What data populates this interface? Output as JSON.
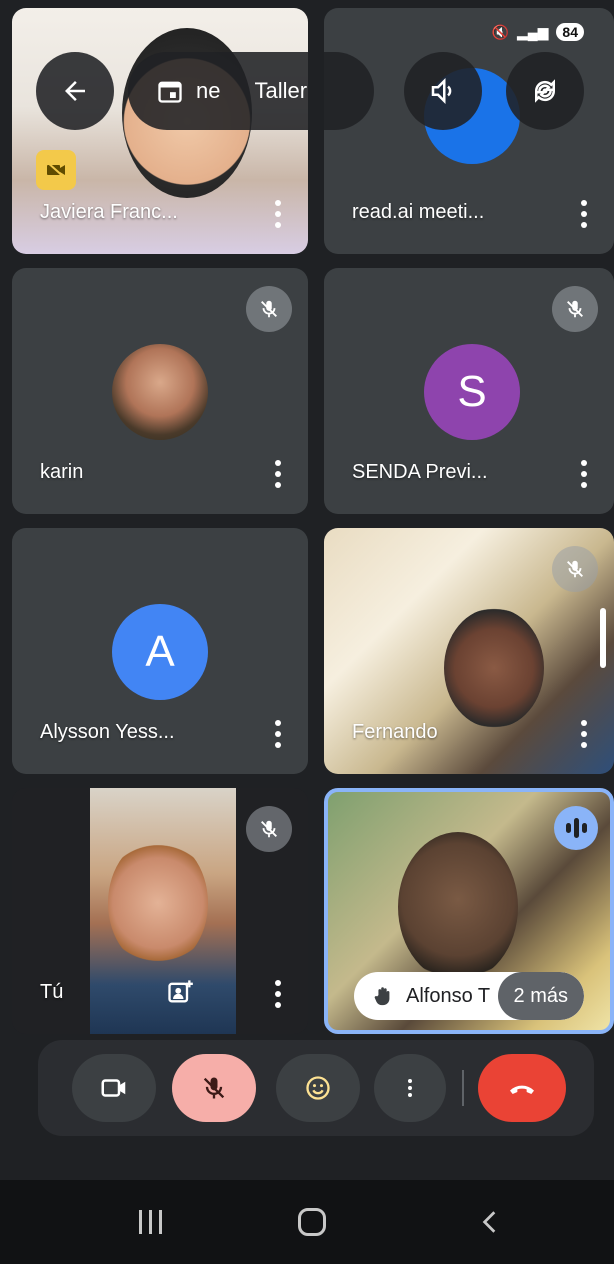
{
  "status_bar": {
    "battery": "84"
  },
  "top_bar": {
    "meeting_title_partial": "ne",
    "meeting_title_partial_2": "Taller"
  },
  "tiles": {
    "javiera": {
      "name": "Javiera Franc..."
    },
    "readai": {
      "name": "read.ai meeti...",
      "avatar_color": "#1a73e8"
    },
    "karin": {
      "name": "karin"
    },
    "senda": {
      "name": "SENDA Previ...",
      "avatar_letter": "S",
      "avatar_color": "#8e44ad"
    },
    "alysson": {
      "name": "Alysson Yess...",
      "avatar_letter": "A",
      "avatar_color": "#4285f4"
    },
    "fernando": {
      "name": "Fernando"
    },
    "tu": {
      "name": "Tú"
    },
    "alfonso": {
      "name": "Alfonso T",
      "more": "2 más"
    }
  },
  "colors": {
    "accent": "#8ab4f8",
    "end_call": "#ea4335",
    "mic_off_bg": "#f6aea9"
  }
}
